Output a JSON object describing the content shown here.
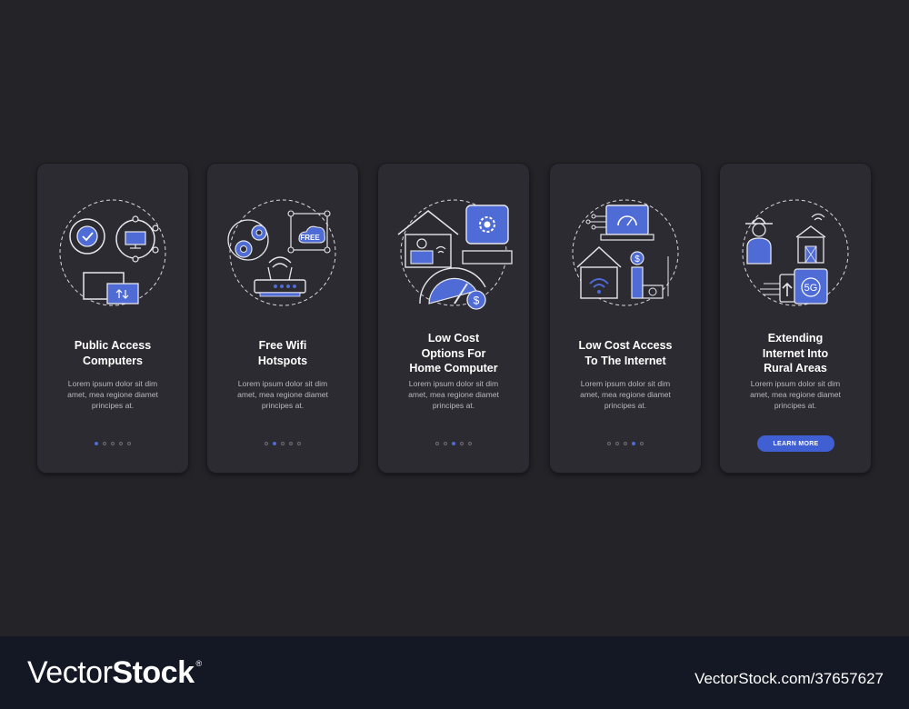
{
  "colors": {
    "background": "#232328",
    "card": "#2b2b31",
    "accent": "#4f6cd6",
    "button": "#3f5fd2",
    "footer": "#141824"
  },
  "cards": [
    {
      "title": "Public Access\nComputers",
      "body": "Lorem ipsum dolor sit dim\namet, mea regione diamet\nprincipes at.",
      "icon": "public-access-computers-icon",
      "active_dot": 0
    },
    {
      "title": "Free Wifi\nHotspots",
      "body": "Lorem ipsum dolor sit dim\namet, mea regione diamet\nprincipes at.",
      "icon": "free-wifi-hotspots-icon",
      "free_label": "FREE",
      "active_dot": 1
    },
    {
      "title": "Low Cost\nOptions For\nHome Computer",
      "body": "Lorem ipsum dolor sit dim\namet, mea regione diamet\nprincipes at.",
      "icon": "home-computer-icon",
      "currency": "$",
      "active_dot": 2
    },
    {
      "title": "Low Cost Access\nTo The Internet",
      "body": "Lorem ipsum dolor sit dim\namet, mea regione diamet\nprincipes at.",
      "icon": "internet-access-icon",
      "currency": "$",
      "active_dot": 3
    },
    {
      "title": "Extending\nInternet Into\nRural Areas",
      "body": "Lorem ipsum dolor sit dim\namet, mea regione diamet\nprincipes at.",
      "icon": "rural-internet-icon",
      "network_label": "5G",
      "button_label": "LEARN MORE"
    }
  ],
  "footer": {
    "brand_light": "Vector",
    "brand_bold": "Stock",
    "brand_mark": "®",
    "image_id": "VectorStock.com/37657627"
  }
}
